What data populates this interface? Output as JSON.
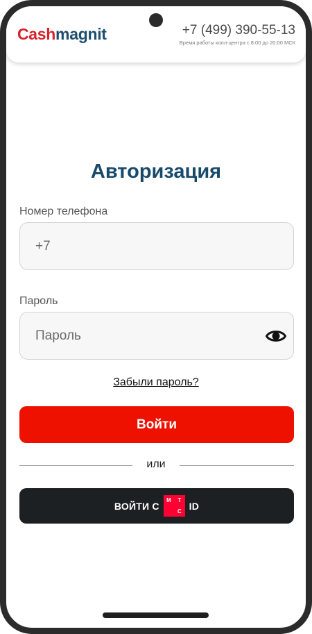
{
  "header": {
    "logo_part1": "Cash",
    "logo_part2": "magnit",
    "phone": "+7 (499) 390-55-13",
    "hours": "Время работы колл-центра с 8:00 до 20:00 МСК"
  },
  "auth": {
    "title": "Авторизация",
    "phone_label": "Номер телефона",
    "phone_value": "+7",
    "password_label": "Пароль",
    "password_placeholder": "Пароль",
    "forgot_link": "Забыли пароль?",
    "login_button": "Войти",
    "divider_text": "или",
    "mts_button": {
      "prefix": "ВОЙТИ С",
      "logo_letters": [
        "М",
        "Т",
        "",
        "С"
      ],
      "suffix": "ID"
    }
  },
  "icons": {
    "eye": "eye-icon",
    "camera": "camera-cutout"
  },
  "colors": {
    "brand_red": "#d8232a",
    "brand_blue": "#1d4e6e",
    "title_blue": "#174a6b",
    "login_red": "#ee1100",
    "mts_dark": "#1d2023",
    "mts_red": "#ff0032"
  }
}
